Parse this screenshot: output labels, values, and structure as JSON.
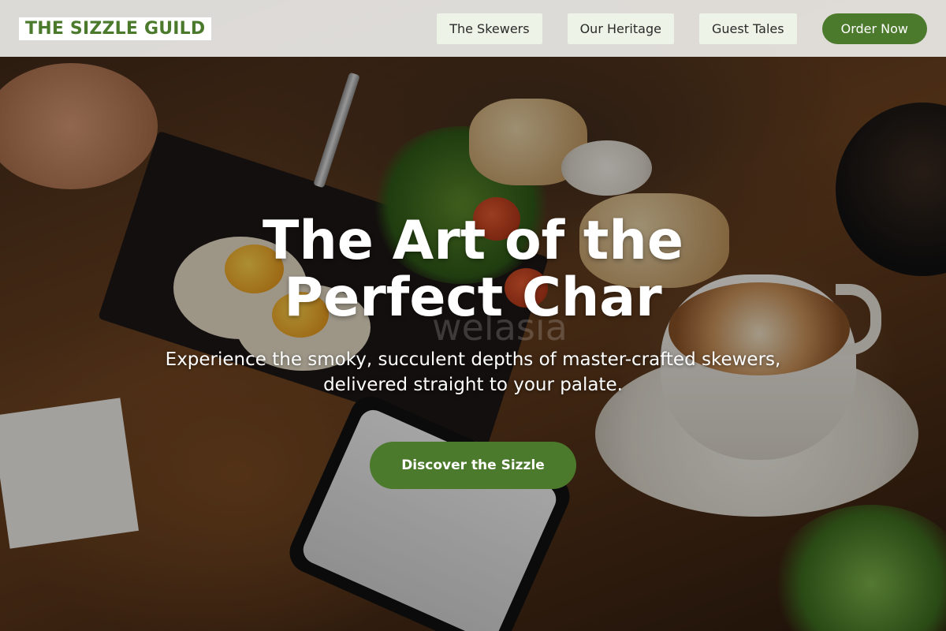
{
  "header": {
    "logo_text": "THE SIZZLE GUILD",
    "nav": [
      {
        "label": "The Skewers"
      },
      {
        "label": "Our Heritage"
      },
      {
        "label": "Guest Tales"
      }
    ],
    "order_label": "Order Now"
  },
  "hero": {
    "title": "The Art of the\nPerfect Char",
    "subtitle": "Experience the smoky, succulent depths of master-crafted skewers, delivered straight to your palate.",
    "cta_label": "Discover the Sizzle",
    "watermark": "welasia"
  },
  "colors": {
    "accent": "#4b7a2c",
    "nav_bg": "#edf3e6"
  }
}
